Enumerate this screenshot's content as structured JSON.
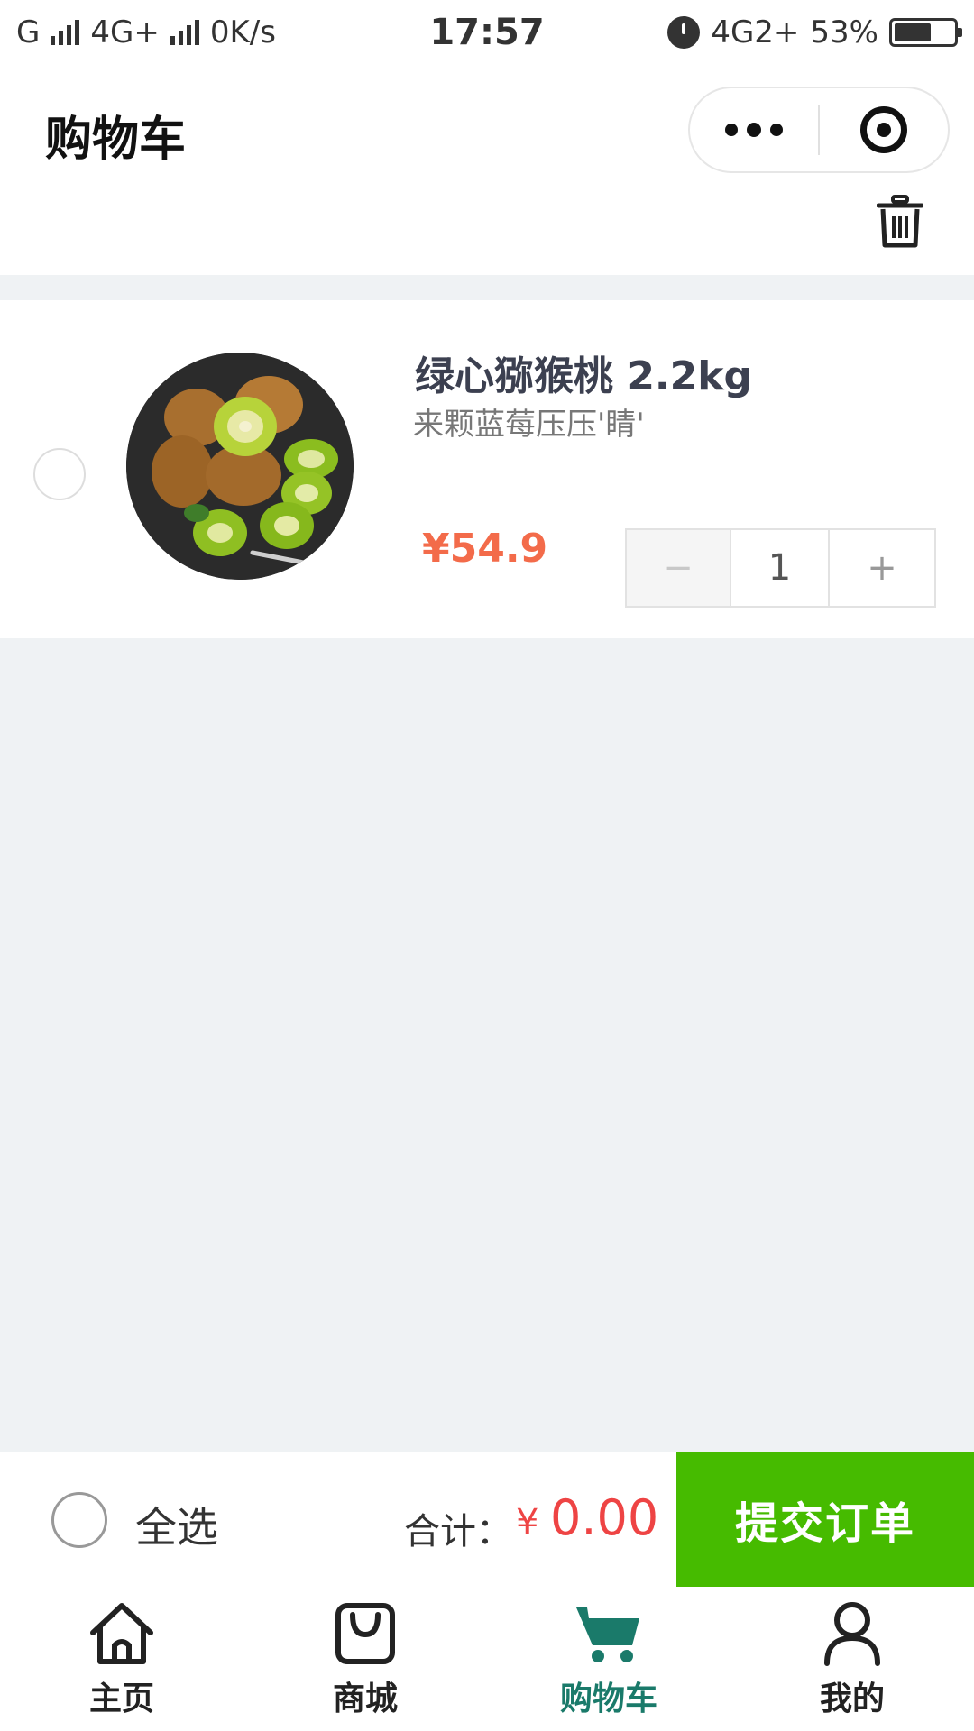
{
  "status_bar": {
    "left": [
      "G",
      "4G+",
      "0K/s"
    ],
    "time": "17:57",
    "network_right": "4G2+",
    "battery_percent": "53%"
  },
  "header": {
    "title": "购物车",
    "more_icon": "more-dots-icon",
    "close_icon": "target-icon",
    "delete_icon": "trash-icon"
  },
  "cart": {
    "items": [
      {
        "title": "绿心猕猴桃 2.2kg",
        "subtitle": "来颗蓝莓压压'睛'",
        "price": "¥54.9",
        "quantity": "1",
        "minus": "−",
        "plus": "+",
        "selected": false
      }
    ]
  },
  "summary": {
    "select_all": "全选",
    "total_label": "合计：",
    "currency": "¥",
    "total": "0.00",
    "submit": "提交订单"
  },
  "tabbar": {
    "active_color": "#1a7a6a",
    "tabs": [
      {
        "label": "主页",
        "icon": "home-icon"
      },
      {
        "label": "商城",
        "icon": "shopping-bag-icon"
      },
      {
        "label": "购物车",
        "icon": "cart-icon"
      },
      {
        "label": "我的",
        "icon": "user-icon"
      }
    ]
  },
  "colors": {
    "submit_button": "#46bb00",
    "price": "#f36b4a",
    "total": "#e44444"
  }
}
